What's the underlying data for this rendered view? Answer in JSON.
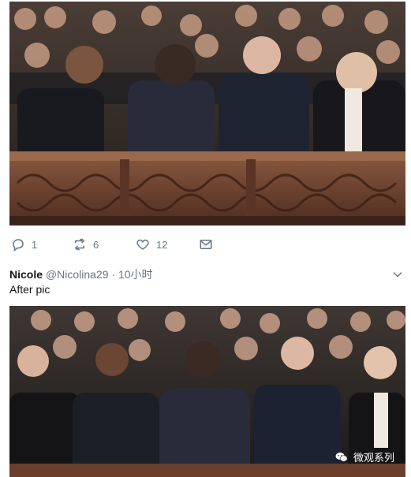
{
  "tweet_top": {
    "actions": {
      "reply_count": "1",
      "retweet_count": "6",
      "like_count": "12"
    },
    "icons": [
      "reply-icon",
      "retweet-icon",
      "like-icon",
      "mail-icon"
    ]
  },
  "tweet": {
    "name": "Nicole",
    "handle": "@Nicolina29",
    "separator": "·",
    "time": "10小时",
    "text": "After pic"
  },
  "watermark": {
    "text": "微观系列"
  },
  "colors": {
    "meta_gray": "#657786",
    "text": "#14171a",
    "wood": "#7a4a34"
  }
}
